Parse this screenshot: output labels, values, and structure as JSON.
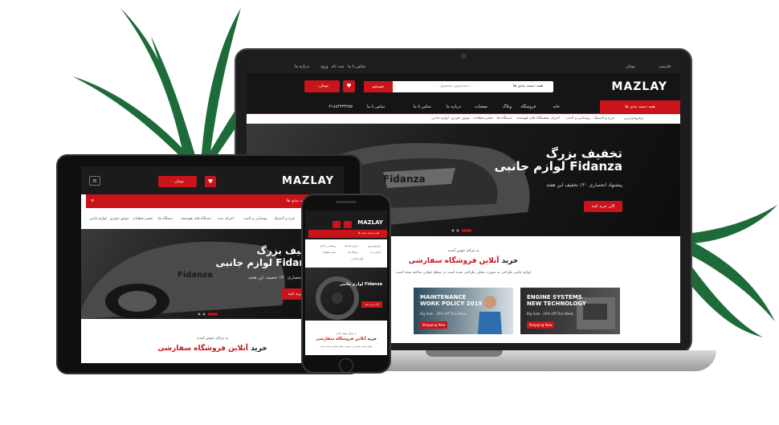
{
  "brand": {
    "logo": "MAZLAY",
    "accent": "#c8141a",
    "dark": "#151515"
  },
  "laptop": {
    "topbar": {
      "lang": "فارسی",
      "currency": "تومان",
      "links": [
        "درباره ما",
        "تماس با ما",
        "وبلاگ"
      ],
      "login": "ورود",
      "register": "ثبت نام"
    },
    "search": {
      "category": "همه دسته بندی ها",
      "placeholder": "جستجوی محصول...",
      "button": "جستجو"
    },
    "cart": "۰ تومان",
    "nav": {
      "categories": "همه دسته بندی ها",
      "items": [
        "خانه",
        "فروشگاه",
        "وبلاگ",
        "صفحات",
        "درباره ما",
        "تماس با ما"
      ],
      "phone": "۰۲۱۸۸۴۳۳۴۲۵۷",
      "phone_label": "تماس با ما"
    },
    "sub_nav": [
      "لوازم جانبی",
      "موتور خودرو",
      "تعمیر قطعات",
      "دستگاه ها",
      "دستگاه های هوشمند",
      "اجزای بدنه",
      "روشنایی و لامپ",
      "چرخ و لاستیک",
      "پرفروش‌ترین"
    ],
    "banner": {
      "title1": "تخفیف بزرگ",
      "title2": "لوازم جانبی Fidanza",
      "subtitle": "پیشنهاد انحصاری ۳۰٪ تخفیف این هفته",
      "button": "الان خرید کنید"
    },
    "welcome": {
      "small": "به مزلای خوش آمدید",
      "title_plain": "خرید",
      "title_red": "آنلاین فروشگاه سفارشی",
      "desc": "لوازم جانبی طراحی به صورت محلی طراحی شده است در سطح جهانی ساخته شده است"
    },
    "cards": [
      {
        "title": "MAINTENANCE WORK POLICY 2019",
        "sub": "Big Sale - 20% Off This Week",
        "button": "Shopping Now"
      },
      {
        "title": "ENGINE SYSTEMS NEW TECHNOLOGY",
        "sub": "Big Sale - 20% Off This Week",
        "button": "Shopping Now"
      }
    ]
  },
  "tablet": {
    "cart": "۰ تومان",
    "categories": "همه دسته بندی ها",
    "sub_nav": [
      "لوازم جانبی",
      "موتور خودرو",
      "تعمیر قطعات",
      "دستگاه ها",
      "دستگاه های هوشمند",
      "اجزای بدنه",
      "روشنایی و لامپ",
      "چرخ و لاستیک"
    ],
    "banner": {
      "title1": "تخفیف بزرگ",
      "title2": "لوازم جانبی Fidanza",
      "subtitle": "پیشنهاد انحصاری ۳۰٪ تخفیف این هفته",
      "button": "الان خرید کنید"
    },
    "welcome": {
      "small": "به مزلای خوش آمدید",
      "title_plain": "خرید",
      "title_red": "آنلاین فروشگاه سفارشی"
    }
  },
  "phone": {
    "categories": "همه دسته بندی ها",
    "sub_nav": [
      "پرفروش‌ترین",
      "چرخ و لاستیک",
      "روشنایی و لامپ",
      "اجزای بدنه",
      "دستگاه ها",
      "تعمیر قطعات",
      "لوازم جانبی"
    ],
    "banner": {
      "title": "لوازم جانبی Fidanza",
      "button": "الان خرید کنید"
    },
    "welcome": {
      "small": "به مزلای خوش آمدید",
      "title_plain": "خرید",
      "title_red": "آنلاین فروشگاه سفارشی",
      "desc": "لوازم جانبی طراحی به صورت محلی طراحی شده است"
    }
  }
}
